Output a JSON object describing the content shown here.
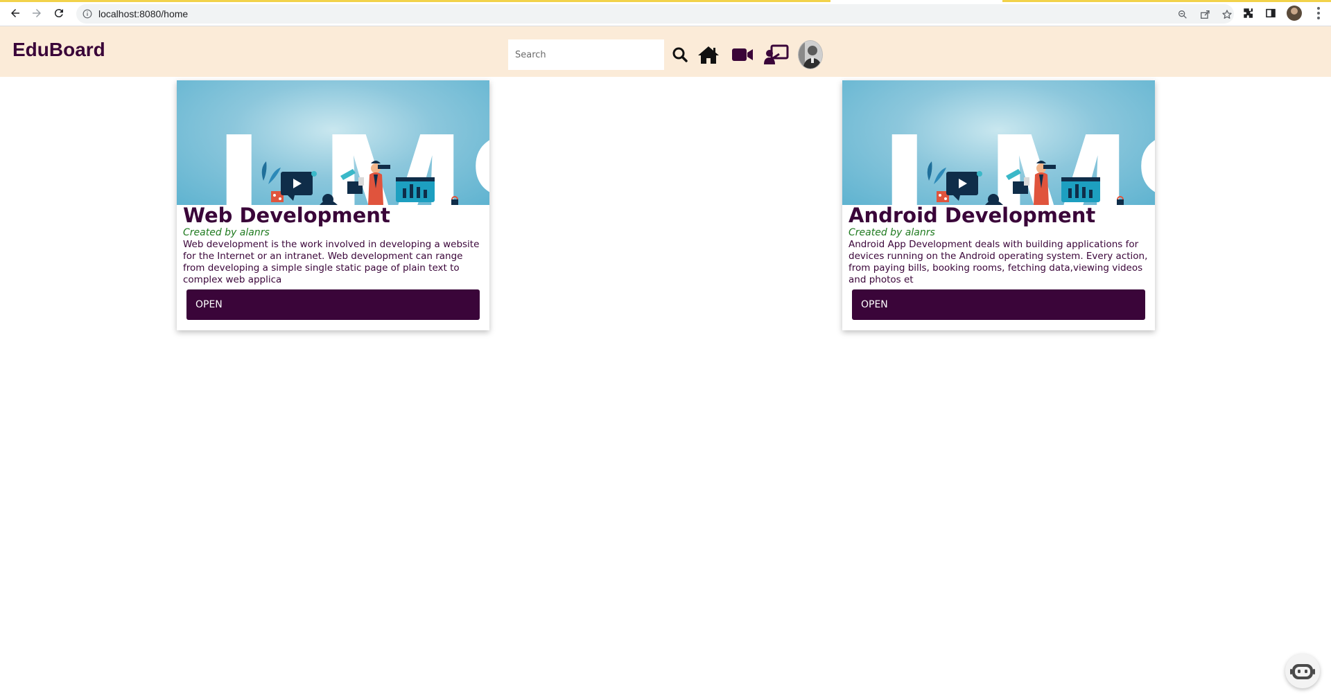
{
  "browser": {
    "url": "localhost:8080/home"
  },
  "header": {
    "brand": "EduBoard",
    "search": {
      "placeholder": "Search",
      "value": ""
    }
  },
  "courses": [
    {
      "banner_text": "LMS",
      "title": "Web Development",
      "author": "Created by alanrs",
      "description": "Web development is the work involved in developing a website for the Internet or an intranet. Web development can range from developing a simple single static page of plain text to complex web applica",
      "button_label": "OPEN"
    },
    {
      "banner_text": "LMS",
      "title": "Android Development",
      "author": "Created by alanrs",
      "description": "Android App Development deals with building applications for devices running on the Android operating system. Every action, from paying bills, booking rooms, fetching data,viewing videos and photos et",
      "button_label": "OPEN"
    }
  ],
  "colors": {
    "brand": "#3a0539",
    "header_bg": "#fbebd8",
    "author": "#1f7a1f",
    "loading_bar": "#f2d24a"
  }
}
